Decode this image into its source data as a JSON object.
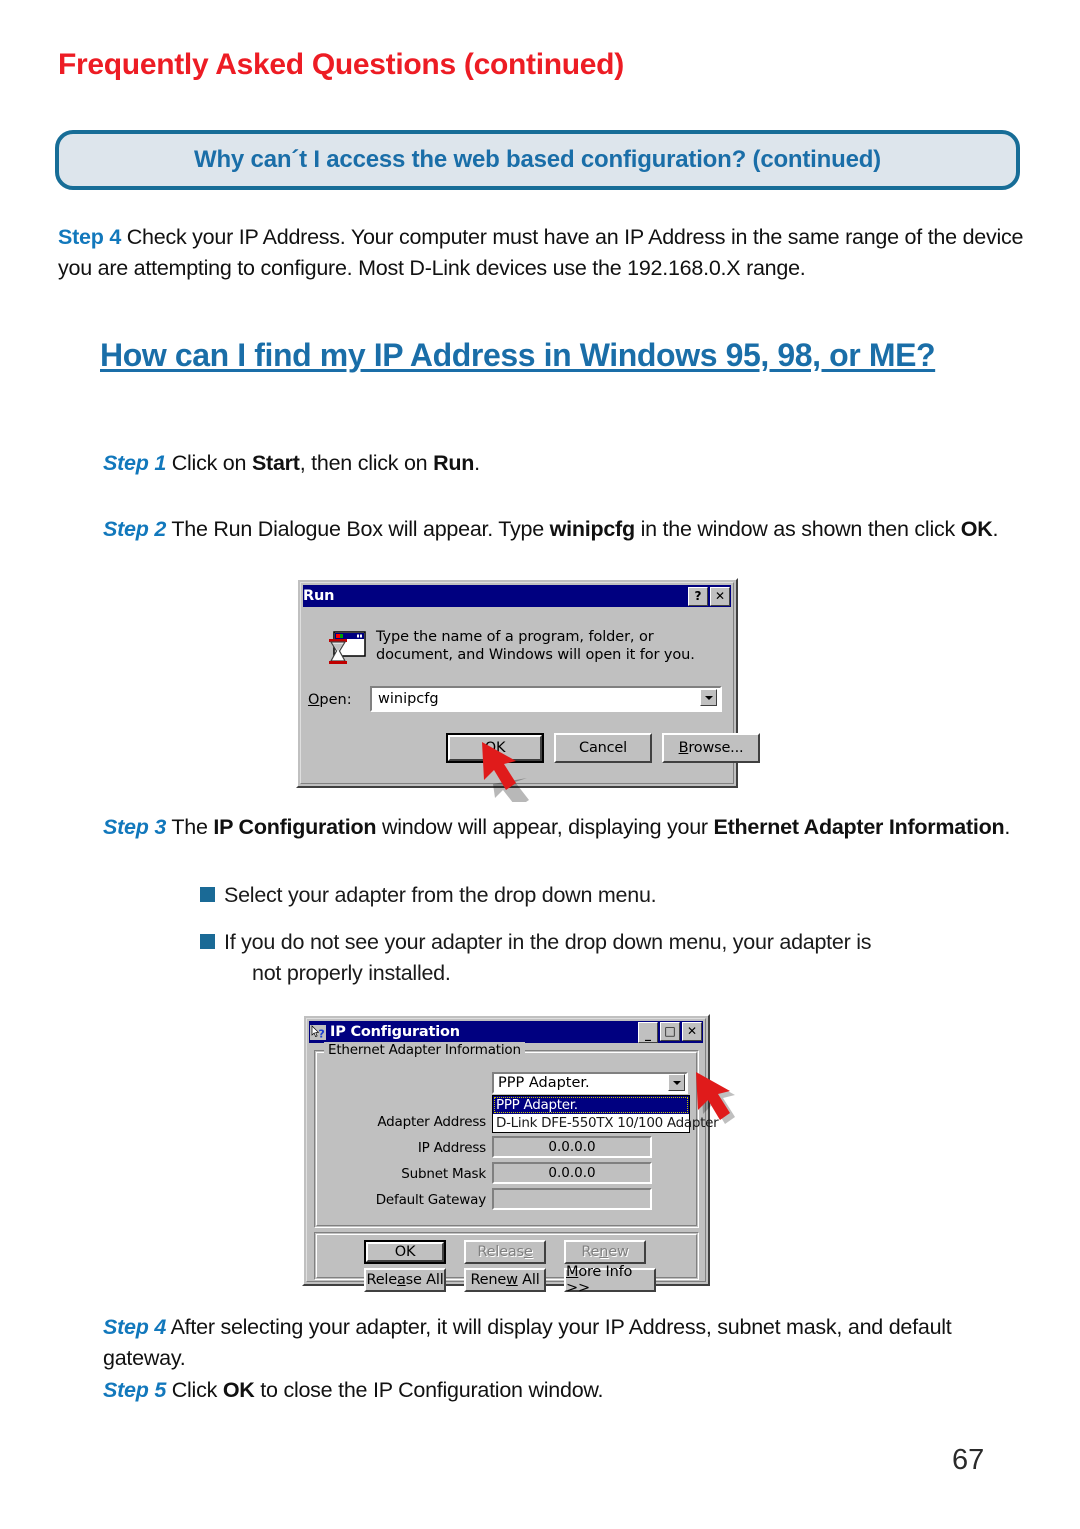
{
  "header": {
    "faq_title": "Frequently Asked Questions (continued)",
    "banner_title": "Why can´t I access the web based configuration? (continued)"
  },
  "content": {
    "step4_top_label": "Step 4",
    "step4_top_text": " Check your IP Address. Your computer must have an IP Address in the same range of the device you are attempting to configure. Most D-Link devices use the 192.168.0.X range.",
    "big_heading": "How can I find my IP Address in Windows 95, 98, or ME?",
    "step1_label": "Step 1",
    "step1_pre": " Click on ",
    "step1_b1": "Start",
    "step1_mid": ", then click on ",
    "step1_b2": "Run",
    "step1_end": ".",
    "step2_label": "Step 2",
    "step2_pre": " The Run Dialogue Box will appear. Type ",
    "step2_b1": "winipcfg",
    "step2_mid": " in the window as shown then click ",
    "step2_b2": "OK",
    "step2_end": ".",
    "step3_label": "Step 3",
    "step3_pre": " The ",
    "step3_b1": "IP Configuration",
    "step3_mid": " window will appear, displaying your ",
    "step3_b2": "Ethernet Adapter Information",
    "step3_end": ".",
    "bullet1": "Select your adapter from the drop down menu.",
    "bullet2a": "If you do not see your adapter in the drop down menu, your adapter is",
    "bullet2b": "not properly installed.",
    "step4b_label": "Step 4",
    "step4b_text": "  After selecting your adapter, it will display your IP Address, subnet mask, and default gateway.",
    "step5_label": "Step 5",
    "step5_pre": " Click ",
    "step5_b1": "OK",
    "step5_end": " to close the IP Configuration window.",
    "page_number": "67"
  },
  "run_dialog": {
    "title": "Run",
    "help_button": "?",
    "close_button": "✕",
    "description": "Type the name of a program, folder, or document, and Windows will open it for you.",
    "open_label": "Open:",
    "open_value": "winipcfg",
    "ok_button": "OK",
    "cancel_button": "Cancel",
    "browse_button": "Browse..."
  },
  "ipconfig_dialog": {
    "title": "IP Configuration",
    "minimize_button": "_",
    "maximize_button": "□",
    "close_button": "✕",
    "group_label": "Ethernet  Adapter Information",
    "combo_value": "PPP Adapter.",
    "dropdown_options": [
      "PPP Adapter.",
      "D-Link DFE-550TX 10/100 Adapter"
    ],
    "fields": [
      {
        "label": "Adapter Address",
        "value": ""
      },
      {
        "label": "IP Address",
        "value": "0.0.0.0"
      },
      {
        "label": "Subnet Mask",
        "value": "0.0.0.0"
      },
      {
        "label": "Default Gateway",
        "value": ""
      }
    ],
    "buttons": {
      "ok": "OK",
      "release": "Release",
      "renew": "Renew",
      "release_all": "Release All",
      "renew_all": "Renew All",
      "more_info": "More Info >>"
    }
  },
  "colors": {
    "faq_red": "#ed1c24",
    "banner_border": "#176d97",
    "banner_fill": "#dde5ec",
    "heading_blue": "#1a6ea8",
    "step_blue": "#1278bc",
    "bullet_blue": "#1a6a96",
    "titlebar_navy": "#000080",
    "dialog_gray": "#c0c0c0",
    "pointer_red": "#e01b1b"
  }
}
